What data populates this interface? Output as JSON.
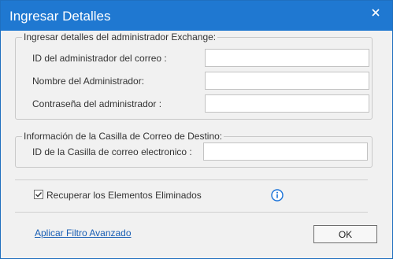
{
  "dialog": {
    "title": "Ingresar Detalles",
    "close_icon": "close-icon"
  },
  "exchange_group": {
    "title": "Ingresar detalles del administrador Exchange:",
    "fields": [
      {
        "label": "ID del administrador del correo :",
        "value": ""
      },
      {
        "label": "Nombre del Administrador:",
        "value": ""
      },
      {
        "label": "Contraseña del administrador :",
        "value": ""
      }
    ]
  },
  "destination_group": {
    "title": "Información de la Casilla de Correo de Destino:",
    "fields": [
      {
        "label": "ID de la Casilla de correo electronico :",
        "value": ""
      }
    ]
  },
  "recover_deleted": {
    "label": "Recuperar los Elementos Eliminados",
    "checked": true,
    "info_icon": "info-icon"
  },
  "advanced_filter_link": "Aplicar Filtro Avanzado",
  "ok_button": "OK",
  "colors": {
    "titlebar": "#1f78d1",
    "dialog_bg": "#f1f1f1",
    "link": "#1a5fb4",
    "info_icon": "#1a73d9"
  }
}
